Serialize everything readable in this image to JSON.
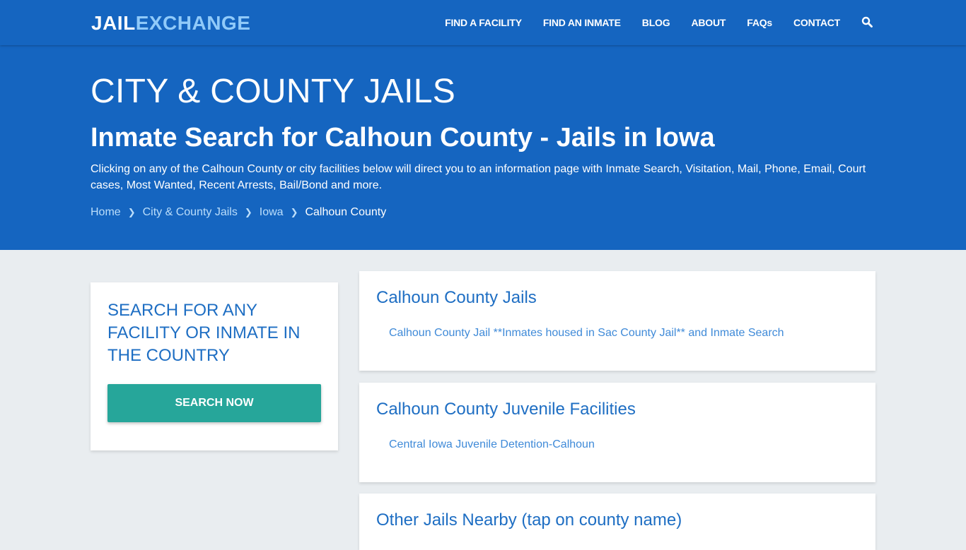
{
  "navbar": {
    "logo_part1": "JAIL",
    "logo_part2": "EXCHANGE",
    "links": [
      "FIND A FACILITY",
      "FIND AN INMATE",
      "BLOG",
      "ABOUT",
      "FAQs",
      "CONTACT"
    ],
    "search_icon": "search-icon"
  },
  "hero": {
    "title": "CITY & COUNTY JAILS",
    "subtitle": "Inmate Search for Calhoun County - Jails in Iowa",
    "description": "Clicking on any of the Calhoun County or city facilities below will direct you to an information page with Inmate Search, Visitation, Mail, Phone, Email, Court cases, Most Wanted, Recent Arrests, Bail/Bond and more.",
    "breadcrumb": [
      "Home",
      "City & County Jails",
      "Iowa",
      "Calhoun County"
    ]
  },
  "sidebar": {
    "heading": "SEARCH FOR ANY FACILITY OR INMATE IN THE COUNTRY",
    "button": "SEARCH NOW"
  },
  "sections": [
    {
      "title": "Calhoun County Jails",
      "links": [
        "Calhoun County Jail **Inmates housed in Sac County Jail** and Inmate Search"
      ]
    },
    {
      "title": "Calhoun County Juvenile Facilities",
      "links": [
        "Central Iowa Juvenile Detention-Calhoun"
      ]
    },
    {
      "title": "Other Jails Nearby (tap on county name)",
      "links": []
    }
  ],
  "colors": {
    "primary": "#1565c0",
    "accent": "#26a69a",
    "link": "#3f8ad8",
    "heading": "#1e6ec3",
    "background": "#e9edf0"
  }
}
